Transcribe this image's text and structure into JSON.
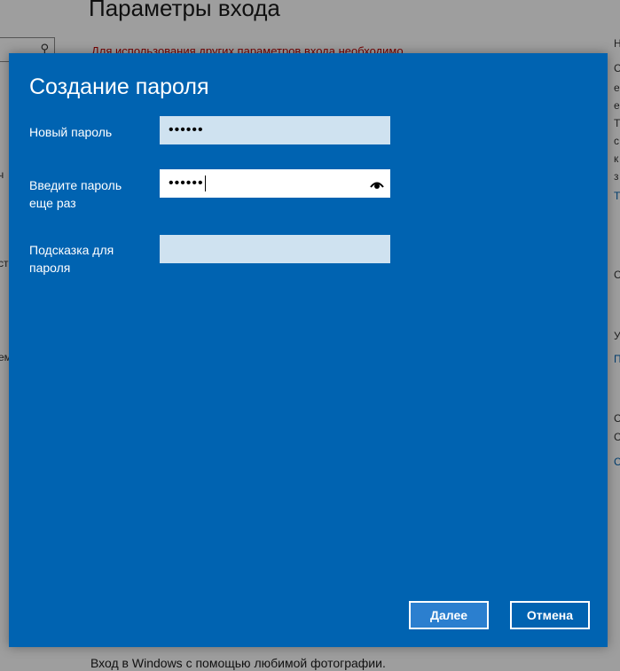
{
  "background": {
    "page_title": "Параметры входа",
    "warning_text": "Для использования других параметров входа необходимо",
    "bottom_text": "Вход в Windows с помощью любимой фотографии.",
    "right_fragments": [
      "Н",
      "С",
      "е",
      "е",
      "Т",
      "с",
      "к",
      "з",
      "Т",
      "С",
      "У",
      "П",
      "С",
      "С",
      "С"
    ],
    "left_fragments": [
      "ч",
      "ст",
      "ем"
    ]
  },
  "dialog": {
    "title": "Создание пароля",
    "fields": [
      {
        "label": "Новый пароль",
        "value": "••••••",
        "masked": true
      },
      {
        "label": "Введите пароль еще раз",
        "value": "••••••",
        "masked": true,
        "focused": true
      },
      {
        "label": "Подсказка для пароля",
        "value": ""
      }
    ],
    "next_button": "Далее",
    "cancel_button": "Отмена"
  },
  "colors": {
    "dialog_bg": "#0063b1",
    "input_bg": "#cfe2f0",
    "text": "#ffffff",
    "warning": "#c00000"
  },
  "icons": {
    "reveal_password": "eye-icon",
    "search": "search-icon"
  }
}
